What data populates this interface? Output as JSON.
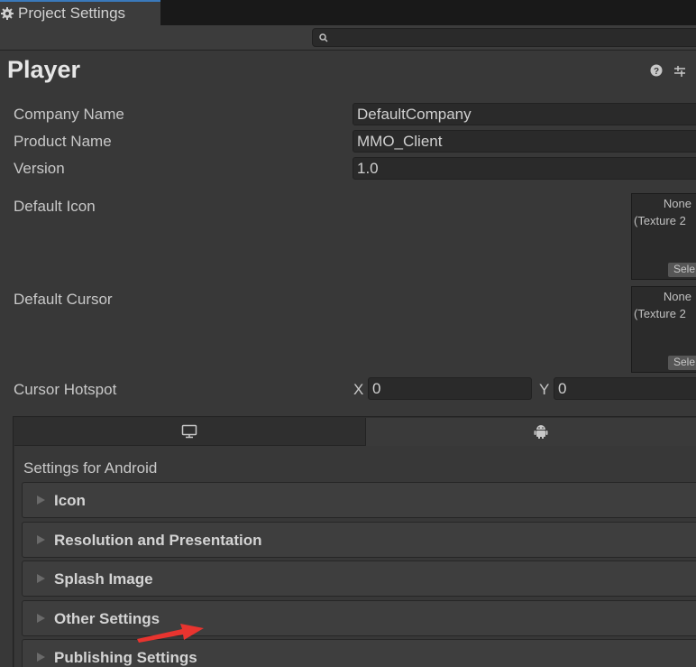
{
  "window": {
    "tab_label": "Project Settings",
    "search_placeholder": ""
  },
  "header": {
    "title": "Player",
    "help_icon": "help-icon",
    "preset_icon": "preset-sliders-icon"
  },
  "fields": {
    "company_name": {
      "label": "Company Name",
      "value": "DefaultCompany"
    },
    "product_name": {
      "label": "Product Name",
      "value": "MMO_Client"
    },
    "version": {
      "label": "Version",
      "value": "1.0"
    },
    "default_icon": {
      "label": "Default Icon",
      "line1": "None",
      "line2": "(Texture 2",
      "select": "Sele"
    },
    "default_cursor": {
      "label": "Default Cursor",
      "line1": "None",
      "line2": "(Texture 2",
      "select": "Sele"
    },
    "cursor_hotspot": {
      "label": "Cursor Hotspot",
      "x_label": "X",
      "x_value": "0",
      "y_label": "Y",
      "y_value": "0"
    }
  },
  "platforms": {
    "tabs": [
      {
        "icon": "monitor-icon",
        "selected": false
      },
      {
        "icon": "android-icon",
        "selected": true
      }
    ],
    "settings_for": "Settings for Android"
  },
  "sections": [
    {
      "title": "Icon"
    },
    {
      "title": "Resolution and Presentation"
    },
    {
      "title": "Splash Image"
    },
    {
      "title": "Other Settings"
    },
    {
      "title": "Publishing Settings"
    }
  ],
  "colors": {
    "background": "#383838",
    "field_bg": "#2a2a2a",
    "accent_tab": "#3a79bb",
    "annotation_arrow": "#e8342f"
  }
}
